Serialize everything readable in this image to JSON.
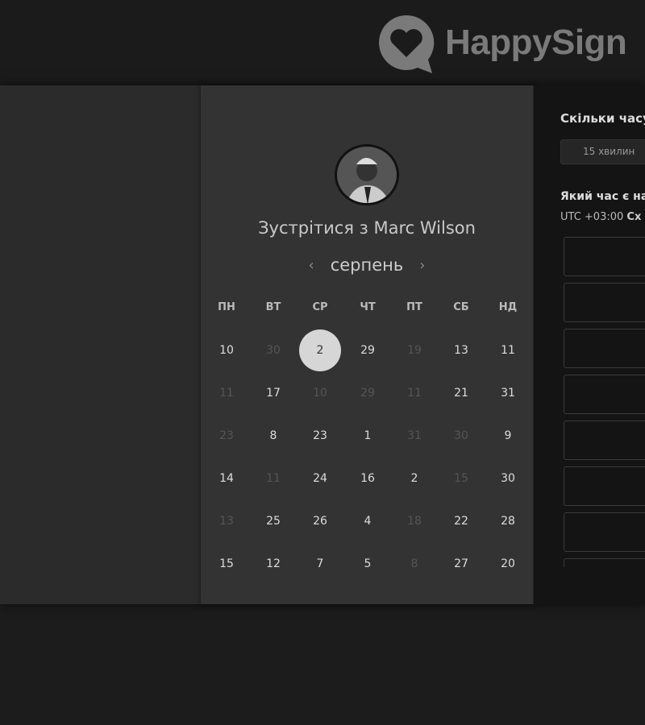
{
  "brand": {
    "name": "HappySign",
    "icon": "heart-speech-bubble-icon"
  },
  "booking": {
    "title": "Зустрітися з Marc Wilson",
    "month": "серпень",
    "prev_icon": "chevron-left-icon",
    "next_icon": "chevron-right-icon",
    "weekdays": [
      "ПН",
      "ВТ",
      "СР",
      "ЧТ",
      "ПТ",
      "СБ",
      "НД"
    ],
    "weeks": [
      [
        {
          "d": "10"
        },
        {
          "d": "30",
          "dim": true
        },
        {
          "d": "2",
          "selected": true
        },
        {
          "d": "29"
        },
        {
          "d": "19",
          "dim": true
        },
        {
          "d": "13"
        },
        {
          "d": "11"
        }
      ],
      [
        {
          "d": "11",
          "dim": true
        },
        {
          "d": "17"
        },
        {
          "d": "10",
          "dim": true
        },
        {
          "d": "29",
          "dim": true
        },
        {
          "d": "11",
          "dim": true
        },
        {
          "d": "21"
        },
        {
          "d": "31"
        }
      ],
      [
        {
          "d": "23",
          "dim": true
        },
        {
          "d": "8"
        },
        {
          "d": "23"
        },
        {
          "d": "1"
        },
        {
          "d": "31",
          "dim": true
        },
        {
          "d": "30",
          "dim": true
        },
        {
          "d": "9"
        }
      ],
      [
        {
          "d": "14"
        },
        {
          "d": "11",
          "dim": true
        },
        {
          "d": "24"
        },
        {
          "d": "16"
        },
        {
          "d": "2"
        },
        {
          "d": "15",
          "dim": true
        },
        {
          "d": "30"
        }
      ],
      [
        {
          "d": "13",
          "dim": true
        },
        {
          "d": "25"
        },
        {
          "d": "26"
        },
        {
          "d": "4"
        },
        {
          "d": "18",
          "dim": true
        },
        {
          "d": "22"
        },
        {
          "d": "28"
        }
      ],
      [
        {
          "d": "15"
        },
        {
          "d": "12"
        },
        {
          "d": "7"
        },
        {
          "d": "5"
        },
        {
          "d": "8",
          "dim": true
        },
        {
          "d": "27"
        },
        {
          "d": "20"
        }
      ]
    ]
  },
  "side": {
    "duration_question": "Скільки часу",
    "duration_value": "15 хвилин",
    "time_question": "Який час є на",
    "timezone_offset": "UTC +03:00",
    "timezone_name": "Сх",
    "slot_count": 8
  }
}
